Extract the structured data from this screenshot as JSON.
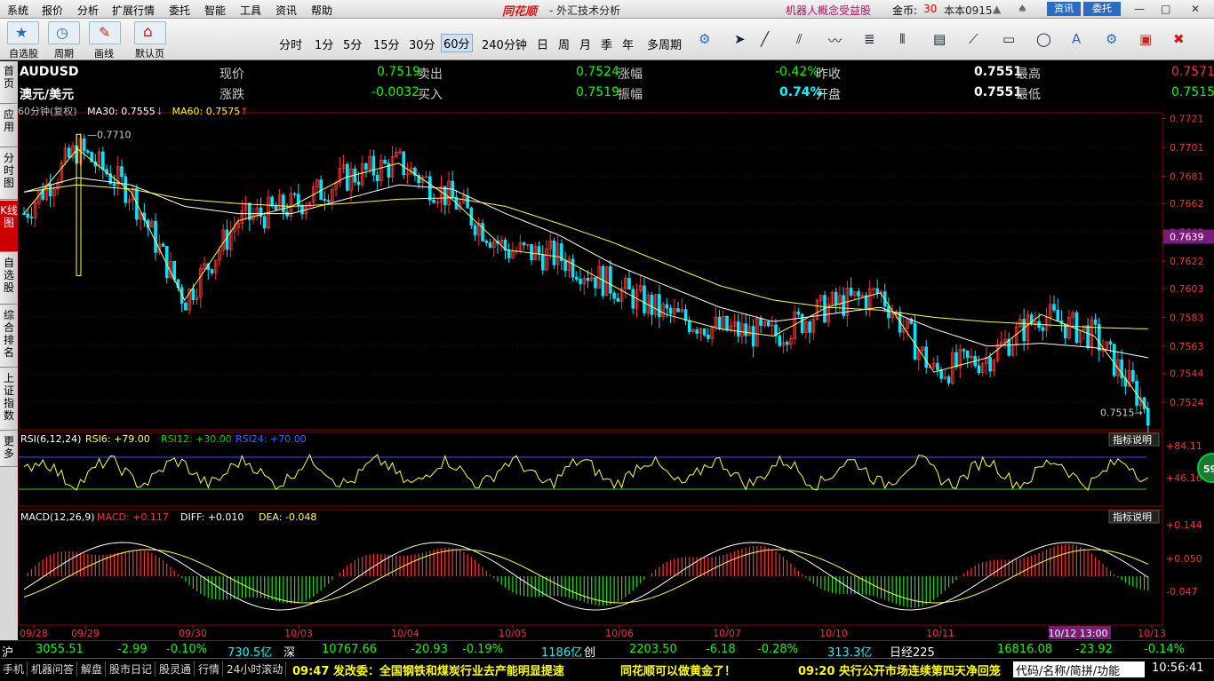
{
  "menu": {
    "items": [
      "系统",
      "报价",
      "分析",
      "扩展行情",
      "委托",
      "智能",
      "工具",
      "资讯",
      "帮助"
    ],
    "brand": "同花顺",
    "title": "- 外汇技术分析",
    "promo": "机器人概念受益股",
    "gold_label": "金币:",
    "gold_value": "30",
    "version": "本本0915",
    "news_btn": "资讯",
    "trade_btn": "委托"
  },
  "toolbar": {
    "big_buttons": [
      "自选股",
      "周期",
      "画线",
      "默认页"
    ],
    "periods": [
      "分时",
      "1分",
      "5分",
      "15分",
      "30分",
      "60分",
      "240分钟",
      "日",
      "周",
      "月",
      "季",
      "年",
      "多周期"
    ],
    "selected_period": "60分"
  },
  "sidetabs": [
    "首页",
    "应用",
    "分时图",
    "K线图",
    "自选股",
    "综合排名",
    "上证指数",
    "更多"
  ],
  "quote": {
    "symbol": "AUDUSD",
    "name": "澳元/美元",
    "labels": {
      "price": "现价",
      "sell": "卖出",
      "change_pct": "涨幅",
      "prev_close": "昨收",
      "high": "最高",
      "change": "涨跌",
      "buy": "买入",
      "amplitude": "振幅",
      "open": "开盘",
      "low": "最低"
    },
    "price": "0.7519",
    "sell": "0.7524",
    "change_pct": "-0.42%",
    "prev_close": "0.7551",
    "high": "0.7571",
    "change": "-0.0032",
    "buy": "0.7519",
    "amplitude": "0.74%",
    "open": "0.7551",
    "low": "0.7515"
  },
  "chart_info": {
    "period_label": "60分钟(复权)",
    "ma30": "MA30: 0.7555",
    "ma60": "MA60: 0.7575",
    "current_price_tag": "0.7639",
    "high_marker": "0.7710",
    "low_marker": "0.7515",
    "indicator_help": "指标说明"
  },
  "rsi": {
    "label": "RSI(6,12,24)",
    "rsi6": "RSI6: +79.00",
    "rsi12": "RSI12: +30.00",
    "rsi24": "RSI24: +70.00",
    "yticks": [
      "+84.11",
      "+46.16"
    ],
    "badge": "59"
  },
  "macd": {
    "label": "MACD(12,26,9)",
    "macd": "MACD: +0.117",
    "diff": "DIFF: +0.010",
    "dea": "DEA: -0.048",
    "yticks": [
      "+0.144",
      "+0.050",
      "-0.047"
    ]
  },
  "chart_data": {
    "type": "candlestick",
    "title": "AUDUSD 60分钟(复权)",
    "ylim": [
      0.7505,
      0.7725
    ],
    "yticks": [
      0.7721,
      0.7701,
      0.7681,
      0.7662,
      0.7642,
      0.7622,
      0.7603,
      0.7583,
      0.7563,
      0.7544,
      0.7524
    ],
    "x_ticks": [
      "09/28",
      "09/29",
      "09/30",
      "10/03",
      "10/04",
      "10/05",
      "10/06",
      "10/07",
      "10/10",
      "10/11",
      "10/12 13:00",
      "10/13"
    ],
    "close_series": {
      "x": [
        "09/28",
        "09/29",
        "09/29b",
        "09/30",
        "09/30b",
        "10/03",
        "10/03b",
        "10/04",
        "10/04b",
        "10/05",
        "10/05b",
        "10/06",
        "10/06b",
        "10/07",
        "10/07b",
        "10/10",
        "10/10b",
        "10/11",
        "10/11b",
        "10/12",
        "10/12b",
        "10/13"
      ],
      "values": [
        0.7655,
        0.77,
        0.767,
        0.7595,
        0.765,
        0.766,
        0.768,
        0.769,
        0.7665,
        0.763,
        0.7625,
        0.7605,
        0.7585,
        0.7575,
        0.757,
        0.759,
        0.76,
        0.7545,
        0.7555,
        0.7585,
        0.757,
        0.7519
      ]
    },
    "ma30": [
      0.767,
      0.768,
      0.7675,
      0.766,
      0.7655,
      0.7655,
      0.7665,
      0.7675,
      0.7672,
      0.7655,
      0.764,
      0.762,
      0.7605,
      0.759,
      0.758,
      0.7585,
      0.759,
      0.7575,
      0.7563,
      0.7565,
      0.7562,
      0.7555
    ],
    "ma60": [
      0.767,
      0.7675,
      0.7672,
      0.7665,
      0.7662,
      0.766,
      0.7662,
      0.7665,
      0.7666,
      0.766,
      0.7648,
      0.7635,
      0.762,
      0.7605,
      0.7595,
      0.759,
      0.7588,
      0.7583,
      0.758,
      0.7578,
      0.7576,
      0.7575
    ],
    "high": 0.771,
    "low": 0.7515
  },
  "status": {
    "sh_label": "沪",
    "sh_index": "3055.51",
    "sh_change": "-2.99",
    "sh_pct": "-0.10%",
    "sh_vol": "730.5亿",
    "sz_label": "深",
    "sz_index": "10767.66",
    "sz_change": "-20.93",
    "sz_pct": "-0.19%",
    "sz_vol": "1186亿",
    "cy_label": "创",
    "cy_index": "2203.50",
    "cy_change": "-6.18",
    "cy_pct": "-0.28%",
    "cy_vol": "313.3亿",
    "nk_label": "日经225",
    "nk_index": "16816.08",
    "nk_change": "-23.92",
    "nk_pct": "-0.14%"
  },
  "bottom": {
    "tabs": [
      "手机",
      "机器问答",
      "解盘",
      "股市日记",
      "股灵通",
      "行情",
      "24小时滚动"
    ],
    "news1": "09:47 发改委：全国钢铁和煤炭行业去产能明显提速",
    "news2": "同花顺可以做黄金了！",
    "news3": "09:20 央行公开市场连续第四天净回笼",
    "search_hint": "代码/名称/简拼/功能",
    "time": "10:56:41"
  }
}
